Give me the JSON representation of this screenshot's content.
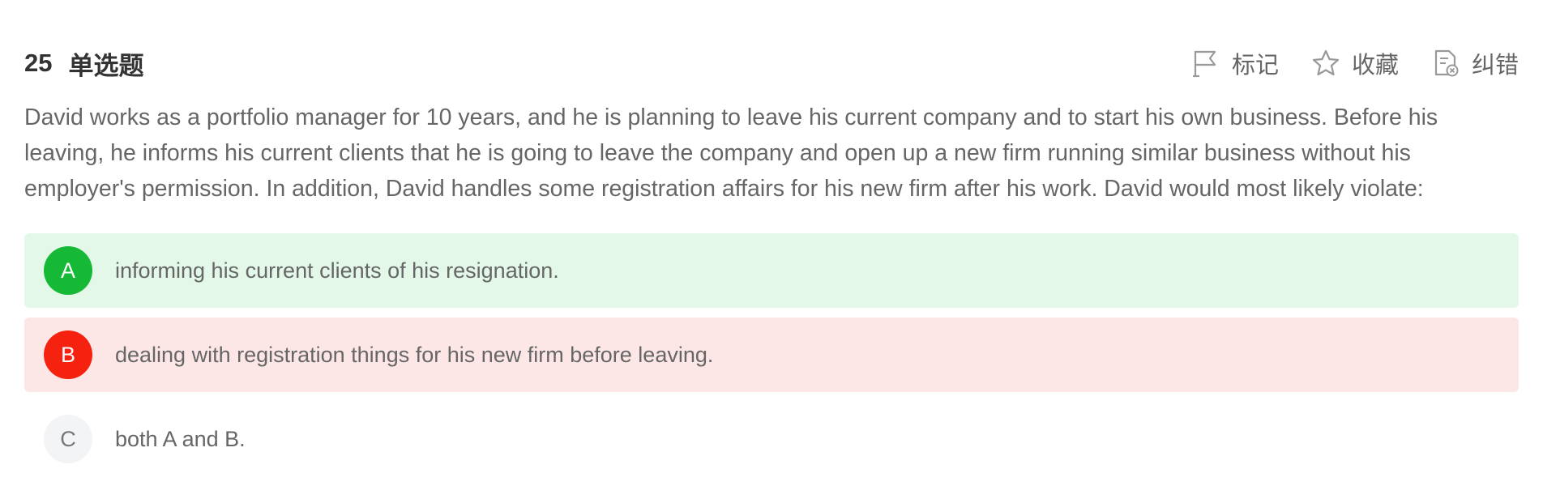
{
  "question": {
    "number": "25",
    "type": "单选题",
    "stem": "David works as a portfolio manager for 10 years, and he is planning to leave his current company and to start his own business. Before his leaving, he informs his current clients that he is going to leave the company and open up a new firm running similar business without his employer's permission. In addition, David handles some registration affairs for his new firm after his work. David would most likely violate:"
  },
  "actions": {
    "mark": {
      "label": "标记",
      "icon": "flag-icon"
    },
    "favorite": {
      "label": "收藏",
      "icon": "star-icon"
    },
    "report": {
      "label": "纠错",
      "icon": "report-error-icon"
    }
  },
  "options": [
    {
      "letter": "A",
      "text": "informing his current clients of his resignation.",
      "state": "correct"
    },
    {
      "letter": "B",
      "text": "dealing with registration things for his new firm before leaving.",
      "state": "wrong"
    },
    {
      "letter": "C",
      "text": "both A and B.",
      "state": "none"
    }
  ],
  "colors": {
    "correct_bg": "#e3f8e8",
    "correct_badge": "#15b936",
    "wrong_bg": "#fde6e6",
    "wrong_badge": "#f5220f",
    "neutral_badge": "#f3f4f6"
  }
}
